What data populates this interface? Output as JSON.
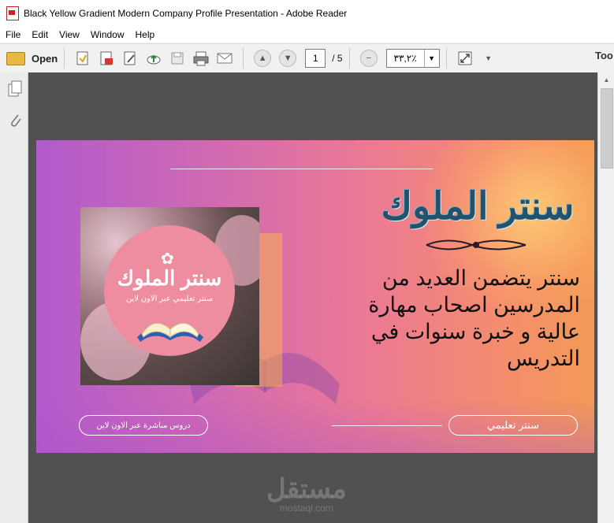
{
  "window": {
    "title": "Black Yellow Gradient Modern Company Profile Presentation - Adobe Reader"
  },
  "menu": {
    "items": [
      "File",
      "Edit",
      "View",
      "Window",
      "Help"
    ]
  },
  "toolbar": {
    "open_label": "Open",
    "current_page": "1",
    "page_total": "/ 5",
    "zoom": "٣٣,٢٪",
    "tools_label": "Too"
  },
  "slide": {
    "title": "سنتر الملوك",
    "body": "سنتر يتضمن العديد من المدرسين اصحاب  مهارة عالية و خبرة سنوات في التدريس",
    "logo_title": "سنتر الملوك",
    "logo_subtitle": "سنتر تعليمي عبر الاون لاين",
    "pill_left": "دروس مباشرة عبر الاون لاين",
    "pill_right": "سنتر تعليمي"
  },
  "watermark": {
    "arabic": "مستقل",
    "latin": "mostaql.com"
  },
  "colors": {
    "doc_background": "#515151",
    "slide_purple": "#b35acd",
    "slide_orange": "#f39a56",
    "title_blue": "#25526b"
  }
}
